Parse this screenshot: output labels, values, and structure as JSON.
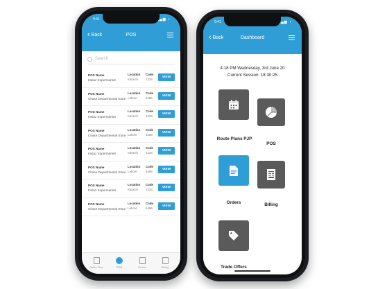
{
  "left_phone": {
    "status_time": "9:41",
    "nav": {
      "back_label": "Back",
      "title": "POS"
    },
    "search_placeholder": "Search",
    "rows": [
      {
        "name_label": "POS Name",
        "name": "Imtiaz Supermarket",
        "loc_label": "Location",
        "location": "Karachi",
        "code_label": "Code",
        "code": "1234",
        "button": "VIEW"
      },
      {
        "name_label": "POS Name",
        "name": "Chase Departmental Store",
        "loc_label": "Location",
        "location": "Lahore",
        "code_label": "Code",
        "code": "6456",
        "button": "VIEW"
      },
      {
        "name_label": "POS Name",
        "name": "Imtiaz Supermarket",
        "loc_label": "Location",
        "location": "Karachi",
        "code_label": "Code",
        "code": "1234",
        "button": "VIEW"
      },
      {
        "name_label": "POS Name",
        "name": "Chase Departmental Store",
        "loc_label": "Location",
        "location": "Lahore",
        "code_label": "Code",
        "code": "6456",
        "button": "VIEW"
      },
      {
        "name_label": "POS Name",
        "name": "Imtiaz Supermarket",
        "loc_label": "Location",
        "location": "Karachi",
        "code_label": "Code",
        "code": "1234",
        "button": "VIEW"
      },
      {
        "name_label": "POS Name",
        "name": "Chase Departmental Store",
        "loc_label": "Location",
        "location": "Lahore",
        "code_label": "Code",
        "code": "6456",
        "button": "VIEW"
      },
      {
        "name_label": "POS Name",
        "name": "Imtiaz Supermarket",
        "loc_label": "Location",
        "location": "Karachi",
        "code_label": "Code",
        "code": "1234",
        "button": "VIEW"
      },
      {
        "name_label": "POS Name",
        "name": "Chase Departmental Store",
        "loc_label": "Location",
        "location": "Lahore",
        "code_label": "Code",
        "code": "6456",
        "button": "VIEW"
      }
    ],
    "tabs": [
      {
        "label": "Route Plan"
      },
      {
        "label": "POS"
      },
      {
        "label": "Orders"
      },
      {
        "label": "Billing"
      }
    ]
  },
  "right_phone": {
    "status_time": "9:41",
    "nav": {
      "back_label": "Back",
      "title": "Dashboard"
    },
    "datetime_line": "4:18 PM Wednesday, 3rd June 20",
    "session_line": "Current Session: 18:30:25",
    "tiles": [
      {
        "label": "Route Plans PJP",
        "icon": "calendar-icon"
      },
      {
        "label": "POS",
        "icon": "pie-chart-icon"
      },
      {
        "label": "Orders",
        "icon": "document-icon"
      },
      {
        "label": "Billing",
        "icon": "bill-icon"
      },
      {
        "label": "Trade Offers",
        "icon": "tag-icon"
      }
    ]
  },
  "colors": {
    "accent": "#2f9ed6",
    "tile_dark": "#5a5a5a"
  }
}
